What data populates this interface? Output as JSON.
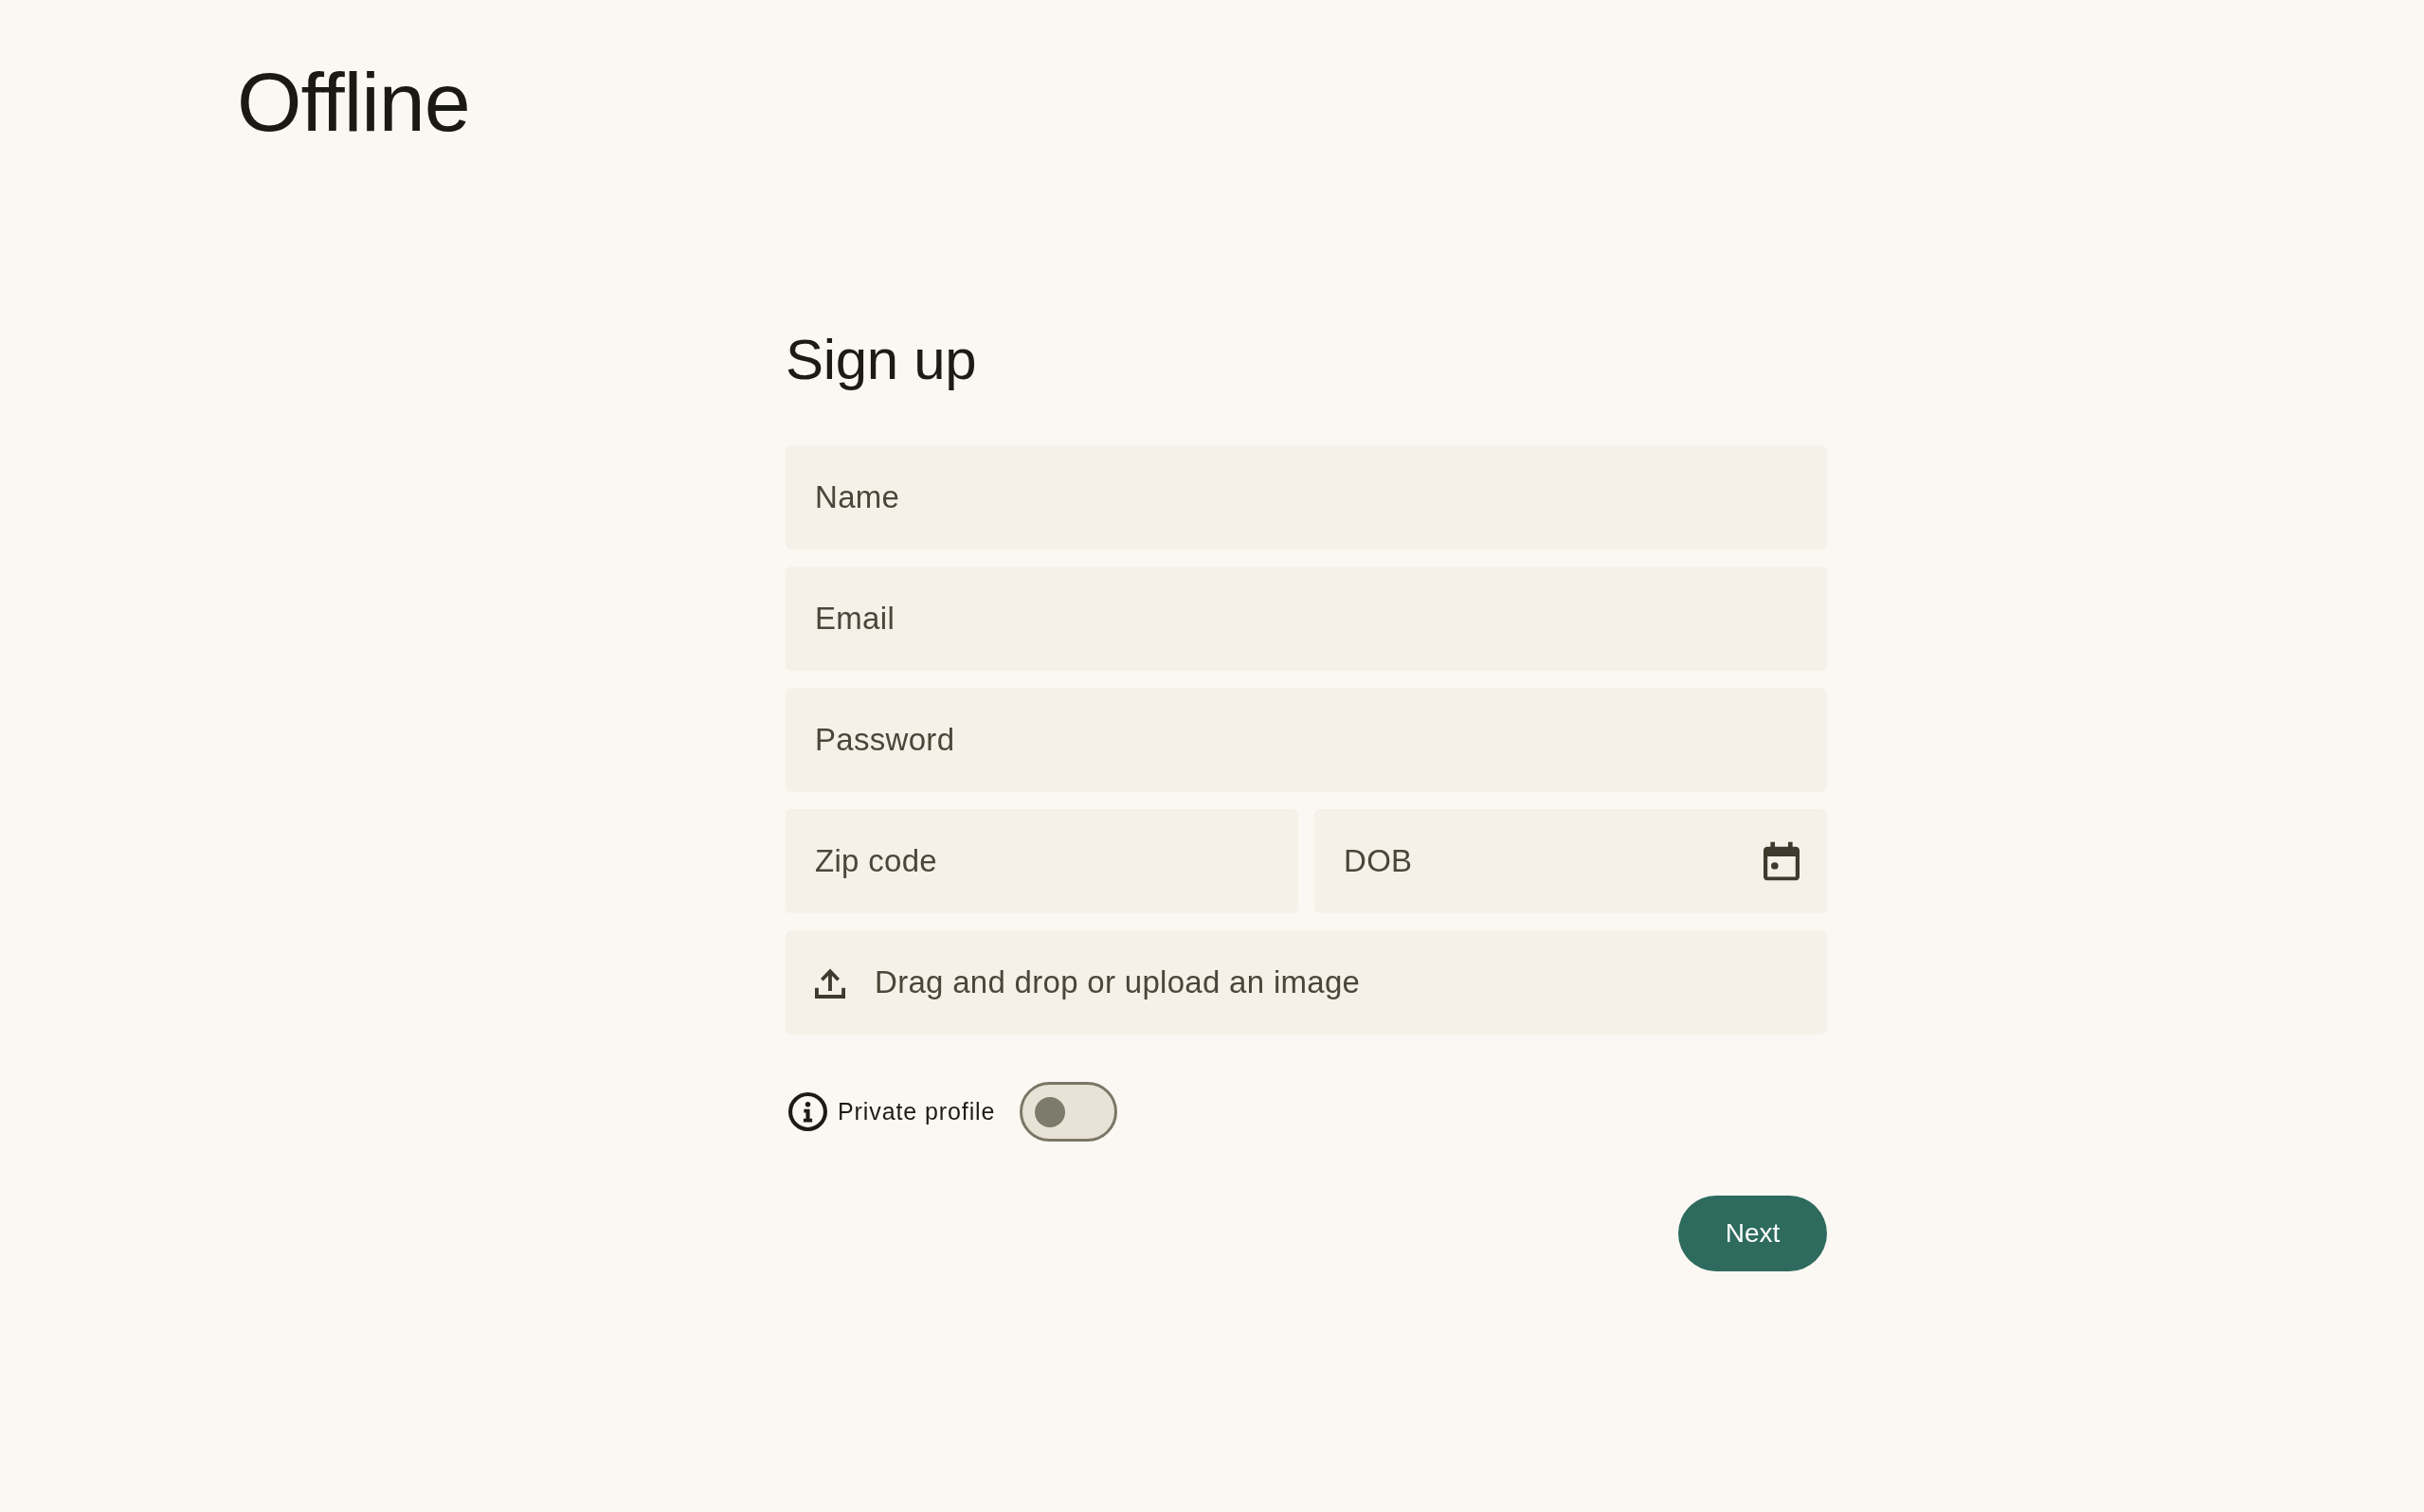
{
  "logo": "Offline",
  "signup_form": {
    "title": "Sign up",
    "rows": [
      [
        {
          "kind": "text",
          "placeholder": "Name"
        }
      ],
      [
        {
          "kind": "text",
          "placeholder": "Email"
        }
      ],
      [
        {
          "kind": "text",
          "placeholder": "Password"
        }
      ],
      [
        {
          "kind": "text",
          "placeholder": "Zip code"
        },
        {
          "kind": "date",
          "placeholder": "DOB"
        }
      ],
      [
        {
          "kind": "upload",
          "label": "Drag and drop or upload an image"
        }
      ]
    ],
    "private_profile": {
      "label": "Private profile",
      "on": false
    },
    "next_button": "Next"
  }
}
